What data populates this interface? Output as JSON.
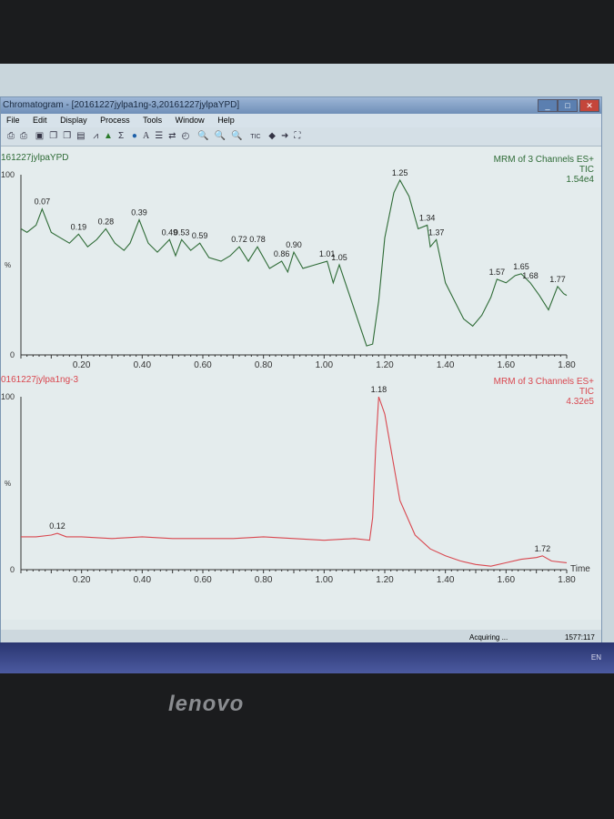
{
  "window": {
    "title": "Chromatogram - [20161227jylpa1ng-3,20161227jylpaYPD]",
    "menu": [
      "File",
      "Edit",
      "Display",
      "Process",
      "Tools",
      "Window",
      "Help"
    ],
    "toolbar_icons": [
      "print-icon",
      "print-preview-icon",
      "camera-icon",
      "copy-icon",
      "copy-list-icon",
      "paste-icon",
      "chromatogram-icon",
      "peaks-icon",
      "integrate-icon",
      "globe-icon",
      "text-icon",
      "list-icon",
      "compare-icon",
      "timer-icon",
      "zoom-in-icon",
      "zoom-out-icon",
      "zoom-reset-icon"
    ],
    "toolbar_tic": "TIC"
  },
  "status": {
    "text": "Acquiring ...",
    "coords": "1577:117",
    "lang": "EN"
  },
  "brand": "lenovo",
  "chart_data": [
    {
      "type": "line",
      "trace_name": "161227jylpaYPD",
      "header": [
        "MRM of 3 Channels ES+",
        "TIC",
        "1.54e4"
      ],
      "color": "#2e6b36",
      "ylabel": "%",
      "yticks": [
        "100",
        "0"
      ],
      "ylim": [
        0,
        100
      ],
      "xlim": [
        0,
        1.8
      ],
      "xticks": [
        "0.20",
        "0.40",
        "0.60",
        "0.80",
        "1.00",
        "1.20",
        "1.40",
        "1.60",
        "1.80"
      ],
      "x": [
        0,
        0.02,
        0.05,
        0.07,
        0.1,
        0.13,
        0.16,
        0.19,
        0.22,
        0.25,
        0.28,
        0.31,
        0.34,
        0.36,
        0.39,
        0.42,
        0.45,
        0.49,
        0.51,
        0.53,
        0.56,
        0.59,
        0.62,
        0.66,
        0.69,
        0.72,
        0.75,
        0.78,
        0.82,
        0.86,
        0.88,
        0.9,
        0.93,
        0.97,
        1.01,
        1.03,
        1.05,
        1.08,
        1.11,
        1.14,
        1.16,
        1.18,
        1.2,
        1.23,
        1.25,
        1.28,
        1.31,
        1.34,
        1.35,
        1.37,
        1.4,
        1.43,
        1.46,
        1.49,
        1.52,
        1.55,
        1.57,
        1.6,
        1.63,
        1.65,
        1.68,
        1.71,
        1.74,
        1.77,
        1.79,
        1.8
      ],
      "y": [
        70,
        68,
        72,
        81,
        68,
        65,
        62,
        67,
        60,
        64,
        70,
        62,
        58,
        62,
        75,
        62,
        57,
        64,
        55,
        64,
        58,
        62,
        54,
        52,
        55,
        60,
        52,
        60,
        48,
        52,
        46,
        57,
        48,
        50,
        52,
        40,
        50,
        35,
        20,
        5,
        6,
        30,
        65,
        90,
        97,
        88,
        70,
        72,
        60,
        64,
        40,
        30,
        20,
        16,
        22,
        32,
        42,
        40,
        44,
        45,
        40,
        33,
        25,
        38,
        34,
        33
      ],
      "peak_labels": [
        {
          "x": 0.07,
          "label": "0.07"
        },
        {
          "x": 0.19,
          "label": "0.19"
        },
        {
          "x": 0.28,
          "label": "0.28"
        },
        {
          "x": 0.39,
          "label": "0.39"
        },
        {
          "x": 0.49,
          "label": "0.49"
        },
        {
          "x": 0.53,
          "label": "0.53"
        },
        {
          "x": 0.59,
          "label": "0.59"
        },
        {
          "x": 0.72,
          "label": "0.72"
        },
        {
          "x": 0.78,
          "label": "0.78"
        },
        {
          "x": 0.86,
          "label": "0.86"
        },
        {
          "x": 0.9,
          "label": "0.90"
        },
        {
          "x": 1.01,
          "label": "1.01"
        },
        {
          "x": 1.05,
          "label": "1.05"
        },
        {
          "x": 1.25,
          "label": "1.25"
        },
        {
          "x": 1.34,
          "label": "1.34"
        },
        {
          "x": 1.37,
          "label": "1.37"
        },
        {
          "x": 1.57,
          "label": "1.57"
        },
        {
          "x": 1.65,
          "label": "1.65"
        },
        {
          "x": 1.68,
          "label": "1.68"
        },
        {
          "x": 1.77,
          "label": "1.77"
        }
      ]
    },
    {
      "type": "line",
      "trace_name": "0161227jylpa1ng-3",
      "header": [
        "MRM of 3 Channels ES+",
        "TIC",
        "4.32e5"
      ],
      "color": "#d9474f",
      "ylabel": "%",
      "yticks": [
        "100",
        "0"
      ],
      "ylim": [
        0,
        100
      ],
      "xlim": [
        0,
        1.8
      ],
      "xlabel": "Time",
      "xticks": [
        "0.20",
        "0.40",
        "0.60",
        "0.80",
        "1.00",
        "1.20",
        "1.40",
        "1.60",
        "1.80"
      ],
      "x": [
        0,
        0.05,
        0.1,
        0.12,
        0.15,
        0.2,
        0.3,
        0.4,
        0.5,
        0.6,
        0.7,
        0.8,
        0.9,
        1.0,
        1.1,
        1.15,
        1.16,
        1.17,
        1.18,
        1.2,
        1.22,
        1.25,
        1.3,
        1.35,
        1.4,
        1.45,
        1.5,
        1.55,
        1.6,
        1.65,
        1.7,
        1.72,
        1.75,
        1.8
      ],
      "y": [
        19,
        19,
        20,
        21,
        19,
        19,
        18,
        19,
        18,
        18,
        18,
        19,
        18,
        17,
        18,
        17,
        30,
        70,
        100,
        90,
        70,
        40,
        20,
        12,
        8,
        5,
        3,
        2,
        4,
        6,
        7,
        8,
        5,
        4
      ],
      "peak_labels": [
        {
          "x": 0.12,
          "label": "0.12"
        },
        {
          "x": 1.18,
          "label": "1.18"
        },
        {
          "x": 1.72,
          "label": "1.72"
        }
      ]
    }
  ]
}
